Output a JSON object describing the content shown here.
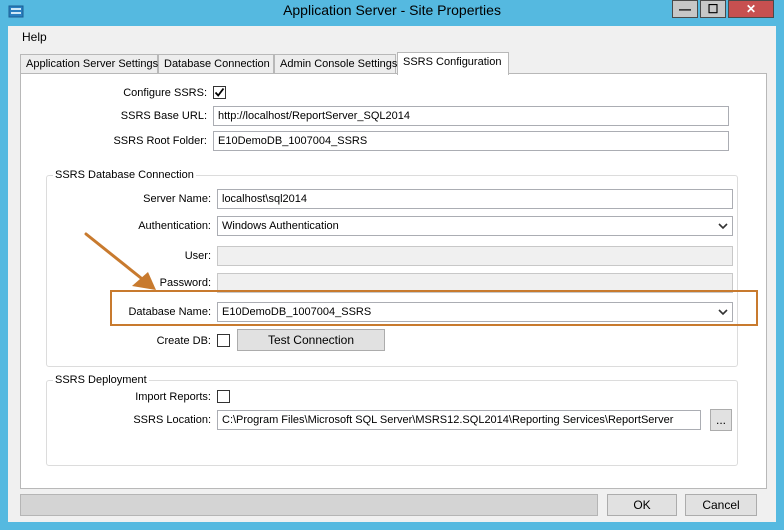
{
  "window": {
    "title": "Application Server - Site Properties",
    "controls": {
      "minimize": "—",
      "maximize": "☐",
      "close": "✕"
    }
  },
  "menu": {
    "help": "Help"
  },
  "tabs": [
    {
      "label": "Application Server Settings"
    },
    {
      "label": "Database Connection"
    },
    {
      "label": "Admin Console Settings"
    },
    {
      "label": "SSRS Configuration",
      "active": true
    }
  ],
  "ssrs": {
    "configure_label": "Configure SSRS:",
    "configure_checked": true,
    "base_url_label": "SSRS Base URL:",
    "base_url_value": "http://localhost/ReportServer_SQL2014",
    "root_folder_label": "SSRS Root Folder:",
    "root_folder_value": "E10DemoDB_1007004_SSRS"
  },
  "db_connection": {
    "group_title": "SSRS Database Connection",
    "server_label": "Server Name:",
    "server_value": "localhost\\sql2014",
    "auth_label": "Authentication:",
    "auth_value": "Windows Authentication",
    "user_label": "User:",
    "user_value": "",
    "password_label": "Password:",
    "password_value": "",
    "dbname_label": "Database Name:",
    "dbname_value": "E10DemoDB_1007004_SSRS",
    "createdb_label": "Create DB:",
    "createdb_checked": false,
    "test_button": "Test Connection"
  },
  "deployment": {
    "group_title": "SSRS Deployment",
    "import_label": "Import Reports:",
    "import_checked": false,
    "location_label": "SSRS Location:",
    "location_value": "C:\\Program Files\\Microsoft SQL Server\\MSRS12.SQL2014\\Reporting Services\\ReportServer",
    "browse_button": "..."
  },
  "footer": {
    "ok": "OK",
    "cancel": "Cancel"
  },
  "colors": {
    "title_bar": "#55b9e0",
    "annotation": "#c87a2e",
    "close_button": "#c75050"
  }
}
